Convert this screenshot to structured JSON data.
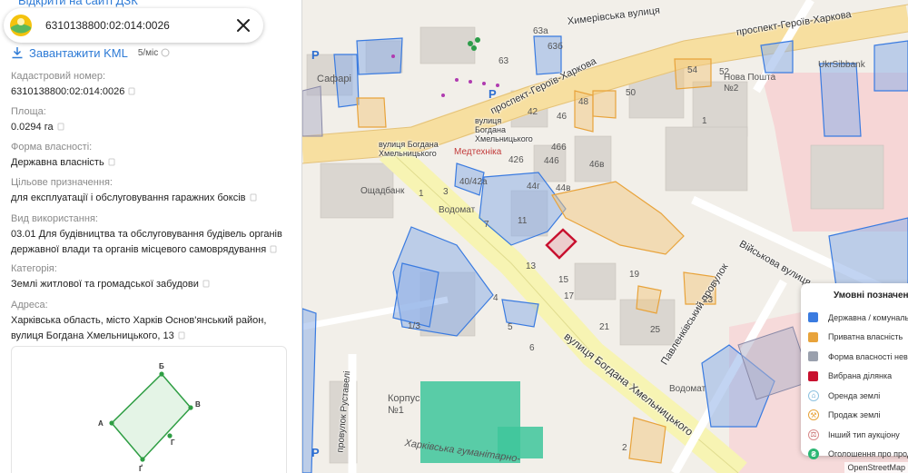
{
  "panel": {
    "top_link": "Відкрити на сайті ДЗК",
    "search_value": "6310138800:02:014:0026",
    "kml_label": "Завантажити KML",
    "rate": "5/міс",
    "fields": [
      {
        "key": "Кадастровий номер:",
        "value": "6310138800:02:014:0026"
      },
      {
        "key": "Площа:",
        "value": "0.0294 га"
      },
      {
        "key": "Форма власності:",
        "value": "Державна власність"
      },
      {
        "key": "Цільове призначення:",
        "value": "для експлуатації і обслуговування гаражних боксів"
      },
      {
        "key": "Вид використання:",
        "value": "03.01 Для будівництва та обслуговування будівель органів державної влади та органів місцевого самоврядування"
      },
      {
        "key": "Категорія:",
        "value": "Землі житлової та громадської забудови"
      },
      {
        "key": "Адреса:",
        "value": "Харківська область, місто Харків Основ'янський район, вулиця Богдана Хмельницького, 13"
      }
    ],
    "shape_vertices": [
      "Б",
      "В",
      "Г",
      "Ґ",
      "А"
    ]
  },
  "map": {
    "streets": {
      "heroiv_kharkova_top": "проспект-Героїв-Харкова",
      "heroiv_kharkova_left": "проспект-Героїв-Харкова",
      "himerivska": "Химерівська вулиця",
      "bohdana_small": "вулиця Богдана Хмельницького",
      "bohdana_left": "вулиця Богдана Хмельницького",
      "bohdana_main": "вулиця Богдана Хмельницького",
      "viiskova": "Військова вулиця",
      "pavlenkivskyi": "Павленківський провулок",
      "rustaveli": "провулок Руставелі"
    },
    "pois": {
      "safari": "Сафарі",
      "nova_poshta": "Нова Пошта №2",
      "ukrsibbank": "UkrSibbank",
      "medtekhnika": "Медтехніка",
      "oshchadbank": "Ощадбанк",
      "vodomat_1": "Водомат",
      "vodomat_2": "Водомат",
      "korpus": "Корпус №1",
      "kharkivska": "Харківська гуманітарно-"
    },
    "house_numbers": [
      "63а",
      "63б",
      "63",
      "42",
      "46",
      "48",
      "50",
      "52",
      "54",
      "1",
      "426",
      "446",
      "466",
      "46в",
      "44в",
      "44г",
      "40/42а",
      "3",
      "1",
      "7",
      "11",
      "13",
      "15",
      "17",
      "19",
      "21",
      "23",
      "25",
      "1/3",
      "4",
      "5",
      "6",
      "2"
    ],
    "attribution": "OpenStreetMap"
  },
  "legend": {
    "title": "Умовні позначення",
    "items": [
      {
        "label": "Державна / комунальна",
        "color": "#3a7be0",
        "icon": "square"
      },
      {
        "label": "Приватна власність",
        "color": "#e8a33b",
        "icon": "square"
      },
      {
        "label": "Форма власності невідома",
        "color": "#9aa0ad",
        "icon": "square"
      },
      {
        "label": "Вибрана ділянка",
        "color": "#c8102e",
        "icon": "square"
      },
      {
        "label": "Оренда землі",
        "color": "#8fc2e0",
        "icon": "rent-icon"
      },
      {
        "label": "Продаж землі",
        "color": "#e8a33b",
        "icon": "sale-icon"
      },
      {
        "label": "Інший тип аукціону",
        "color": "#d98a8a",
        "icon": "auction-icon"
      },
      {
        "label": "Оголошення про продаж",
        "color": "#2bb673",
        "icon": "hryvnia-icon"
      }
    ]
  },
  "colors": {
    "accent": "#2e7bd6",
    "state": "#3a7be0",
    "private": "#e8a33b",
    "selected": "#c8102e",
    "shape_green": "#2f9e44"
  }
}
